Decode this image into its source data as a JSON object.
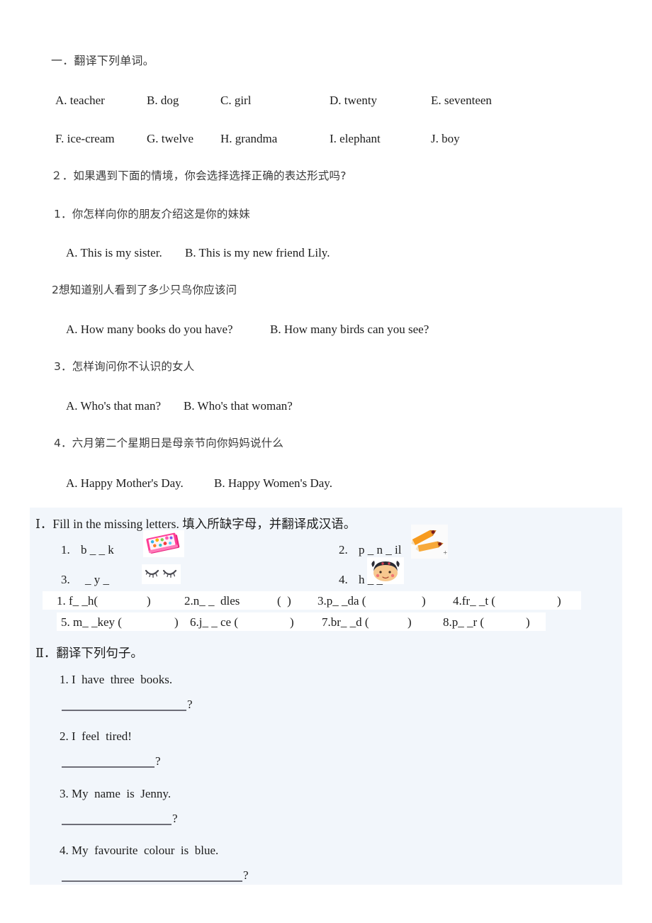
{
  "document": {
    "type": "english-worksheet",
    "background": "#ffffff",
    "highlight_color": "#f2f6fb"
  },
  "section1": {
    "heading": "一．翻译下列单词。",
    "row1": [
      {
        "label": "A. teacher"
      },
      {
        "label": "B. dog"
      },
      {
        "label": "C. girl"
      },
      {
        "label": "D. twenty"
      },
      {
        "label": "E. seventeen"
      }
    ],
    "row2": [
      {
        "label": "F. ice-cream"
      },
      {
        "label": "G. twelve"
      },
      {
        "label": "H. grandma"
      },
      {
        "label": "I. elephant"
      },
      {
        "label": "J. boy"
      }
    ]
  },
  "section2": {
    "heading": "２．如果遇到下面的情境，你会选择选择正确的表达形式吗?",
    "questions": [
      {
        "prompt": "1．你怎样向你的朋友介绍这是你的妹妹",
        "option_a": "A. This is my sister.",
        "option_b": "B. This is my new friend Lily."
      },
      {
        "prompt": "2想知道别人看到了多少只鸟你应该问",
        "option_a": "A. How many books do you have?",
        "option_b": "B. How many birds can you see?"
      },
      {
        "prompt": "3．怎样询问你不认识的女人",
        "option_a": "A. Who's that man?",
        "option_b": "B. Who's that woman?"
      },
      {
        "prompt": "4．六月第二个星期日是母亲节向你妈妈说什么",
        "option_a": "A. Happy Mother's Day.",
        "option_b": "B. Happy Women's Day."
      }
    ]
  },
  "section3": {
    "heading": "Ⅰ．Fill in the missing letters. 填入所缺字母，并翻译成汉语。",
    "picture_items": [
      {
        "number": "1.",
        "word": "b _ _ k",
        "image": "book-picture"
      },
      {
        "number": "2.",
        "word": "p _ n _ il",
        "image": "pencils-picture"
      },
      {
        "number": "3.",
        "word": "_ y _",
        "image": "eyes-picture"
      },
      {
        "number": "4.",
        "word": "h _ _ d",
        "image": "head-picture"
      }
    ],
    "blank_items_row1": [
      "1. f_ _h(",
      "2.n_ _  dles",
      "3.p_ _da (",
      "4.fr_ _t ("
    ],
    "blank_items_row1_full": "1. f_ _h(         )      2.n_ _  dles      (  )      3.p_ _da (           )   4.fr_ _t (             )",
    "blank_items_row2_full": "5. m_ _key (        )  6.j_ _ ce (       )     7.br_ _d (       )     8.p_ _r (         )",
    "row1_cells": [
      {
        "text": "1. f_ _h(",
        "close": ")"
      },
      {
        "text": "2.n_ _  dles",
        "close": "(  )"
      },
      {
        "text": "3.p_ _da (",
        "close": ")"
      },
      {
        "text": "4.fr_ _t (",
        "close": ")"
      }
    ],
    "row2_cells": [
      {
        "text": "5. m_ _key (",
        "close": ")"
      },
      {
        "text": "6.j_ _ ce (",
        "close": ")"
      },
      {
        "text": "7.br_ _d (",
        "close": ")"
      },
      {
        "text": "8.p_ _r (",
        "close": ")"
      }
    ]
  },
  "section4": {
    "heading": "Ⅱ．翻译下列句子。",
    "sentences": [
      {
        "number": "1.",
        "text": "1. I  have  three  books.",
        "answer_mark": "?"
      },
      {
        "number": "2.",
        "text": "2. I  feel  tired!",
        "answer_mark": "?"
      },
      {
        "number": "3.",
        "text": "3. My  name  is  Jenny.",
        "answer_mark": "?"
      },
      {
        "number": "4.",
        "text": "4. My  favourite  colour  is  blue.",
        "answer_mark": "?"
      }
    ]
  }
}
